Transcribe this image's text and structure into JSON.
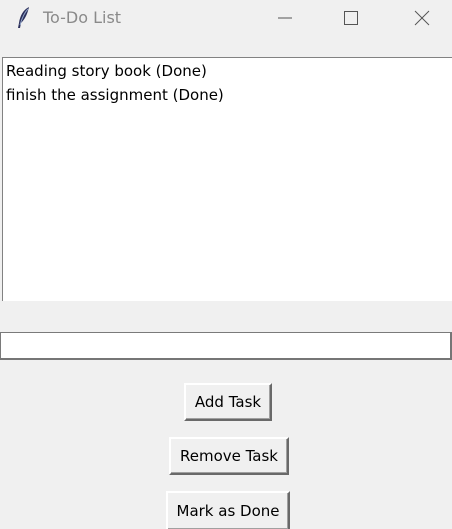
{
  "window": {
    "title": "To-Do List",
    "icon": "feather-icon"
  },
  "title_controls": {
    "minimize_icon": "minimize-icon",
    "maximize_icon": "maximize-icon",
    "close_icon": "close-icon"
  },
  "task_list": {
    "items": [
      "Reading story book (Done)",
      "finish the assignment (Done)"
    ]
  },
  "task_entry": {
    "value": ""
  },
  "buttons": {
    "add_task": "Add Task",
    "remove_task": "Remove Task",
    "mark_done": "Mark as Done"
  }
}
